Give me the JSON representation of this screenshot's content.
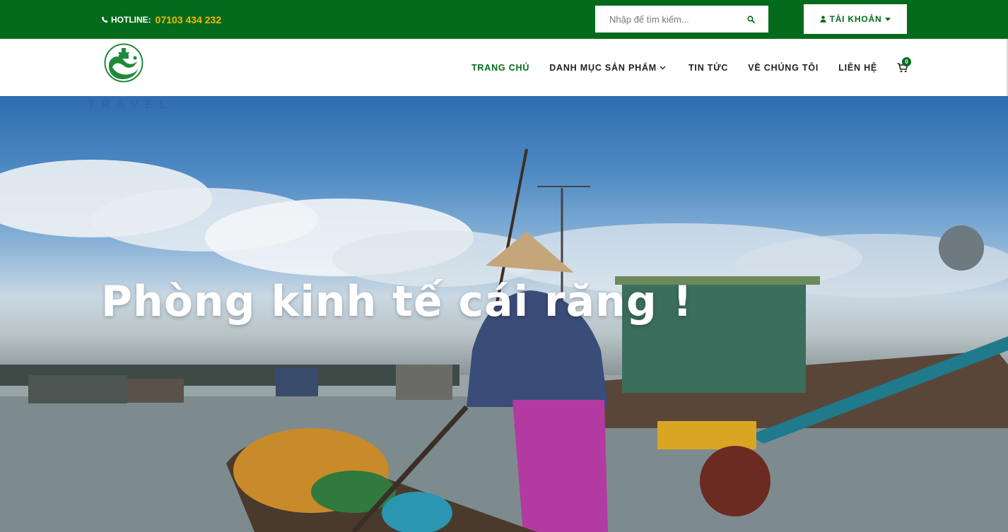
{
  "topbar": {
    "hotline_label": "HOTLINE:",
    "hotline_number": "07103 434 232",
    "search_placeholder": "Nhập để tìm kiếm...",
    "account_label": "TÀI KHOẢN",
    "icons": {
      "phone": "phone-icon",
      "search": "search-icon",
      "account": "user-icon",
      "caret": "caret-down-icon"
    },
    "colors": {
      "bar": "#046b1c",
      "hotline_number": "#f7b500"
    }
  },
  "header": {
    "logo_text": "TRAVEL",
    "nav": [
      {
        "label": "TRANG CHỦ",
        "active": true
      },
      {
        "label": "DANH MỤC SẢN PHẨM",
        "dropdown": true
      },
      {
        "label": "TIN TỨC"
      },
      {
        "label": "VỀ CHÚNG TÔI"
      },
      {
        "label": "LIÊN HỆ"
      }
    ],
    "cart_count": "0",
    "icons": {
      "cart": "cart-icon",
      "dropdown": "chevron-down-icon"
    }
  },
  "hero": {
    "title": "Phòng kinh tế cái răng !"
  }
}
